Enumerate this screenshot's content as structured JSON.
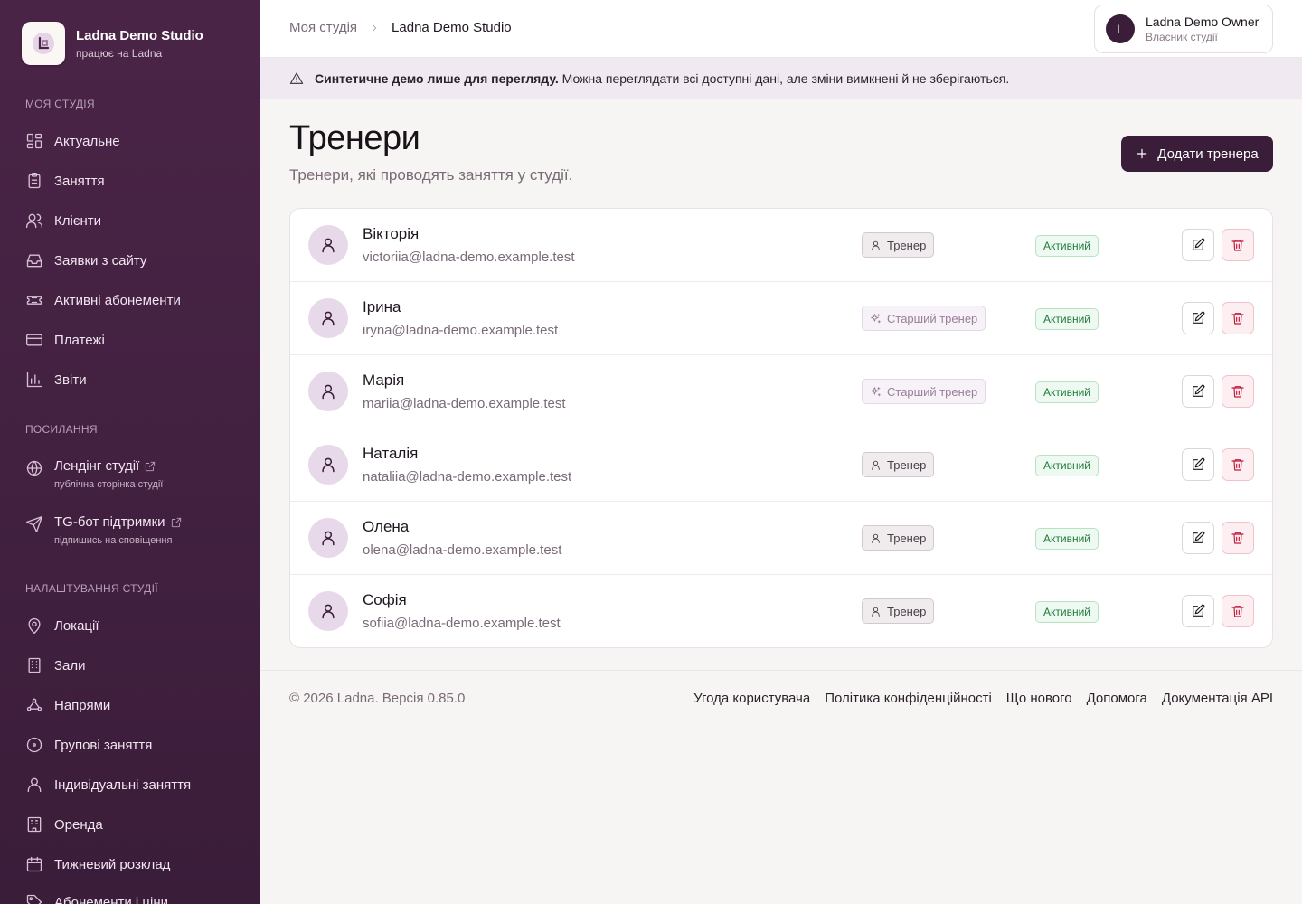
{
  "brand": {
    "name": "Ladna Demo Studio",
    "subtitle": "працює на Ladna"
  },
  "sidebar": {
    "sections": [
      {
        "title": "Моя студія"
      },
      {
        "title": "Посилання"
      },
      {
        "title": "Налаштування студії"
      }
    ],
    "main_items": [
      {
        "label": "Актуальне",
        "icon": "dashboard-icon"
      },
      {
        "label": "Заняття",
        "icon": "clipboard-icon"
      },
      {
        "label": "Клієнти",
        "icon": "users-icon"
      },
      {
        "label": "Заявки з сайту",
        "icon": "inbox-icon"
      },
      {
        "label": "Активні абонементи",
        "icon": "ticket-icon"
      },
      {
        "label": "Платежі",
        "icon": "credit-card-icon"
      },
      {
        "label": "Звіти",
        "icon": "bar-chart-icon"
      }
    ],
    "links": [
      {
        "label": "Лендінг студії",
        "sub": "публічна сторінка студії",
        "icon": "globe-icon"
      },
      {
        "label": "TG-бот підтримки",
        "sub": "підпишись на сповіщення",
        "icon": "send-icon"
      }
    ],
    "settings_items": [
      {
        "label": "Локації",
        "icon": "map-pin-icon"
      },
      {
        "label": "Зали",
        "icon": "building-icon"
      },
      {
        "label": "Напрями",
        "icon": "workflow-icon"
      },
      {
        "label": "Групові заняття",
        "icon": "circle-dot-icon"
      },
      {
        "label": "Індивідуальні заняття",
        "icon": "user-icon"
      },
      {
        "label": "Оренда",
        "icon": "office-icon"
      },
      {
        "label": "Тижневий розклад",
        "icon": "calendar-icon"
      },
      {
        "label": "Абонементи і ціни",
        "icon": "tag-icon"
      }
    ]
  },
  "header": {
    "breadcrumb": [
      "Моя студія",
      "Ladna Demo Studio"
    ],
    "user": {
      "initial": "L",
      "name": "Ladna Demo Owner",
      "role": "Власник студії"
    }
  },
  "banner": {
    "bold": "Синтетичне демо лише для перегляду.",
    "text": " Можна переглядати всі доступні дані, але зміни вимкнені й не зберігаються."
  },
  "page": {
    "title": "Тренери",
    "subtitle": "Тренери, які проводять заняття у студії.",
    "add_button": "Додати тренера"
  },
  "trainers": [
    {
      "name": "Вікторія",
      "email": "victoriia@ladna-demo.example.test",
      "role": "Тренер",
      "role_type": "trainer",
      "status": "Активний"
    },
    {
      "name": "Ірина",
      "email": "iryna@ladna-demo.example.test",
      "role": "Старший тренер",
      "role_type": "senior",
      "status": "Активний"
    },
    {
      "name": "Марія",
      "email": "mariia@ladna-demo.example.test",
      "role": "Старший тренер",
      "role_type": "senior",
      "status": "Активний"
    },
    {
      "name": "Наталія",
      "email": "nataliia@ladna-demo.example.test",
      "role": "Тренер",
      "role_type": "trainer",
      "status": "Активний"
    },
    {
      "name": "Олена",
      "email": "olena@ladna-demo.example.test",
      "role": "Тренер",
      "role_type": "trainer",
      "status": "Активний"
    },
    {
      "name": "Софія",
      "email": "sofiia@ladna-demo.example.test",
      "role": "Тренер",
      "role_type": "trainer",
      "status": "Активний"
    }
  ],
  "footer": {
    "copyright": "© 2026 Ladna. Версія 0.85.0",
    "links": [
      "Угода користувача",
      "Політика конфіденційності",
      "Що нового",
      "Допомога",
      "Документація API"
    ]
  },
  "colors": {
    "sidebar": "#3a1d39",
    "accent": "#3a1d39",
    "active_badge": "#1f7a3b",
    "delete": "#c21d3c"
  }
}
